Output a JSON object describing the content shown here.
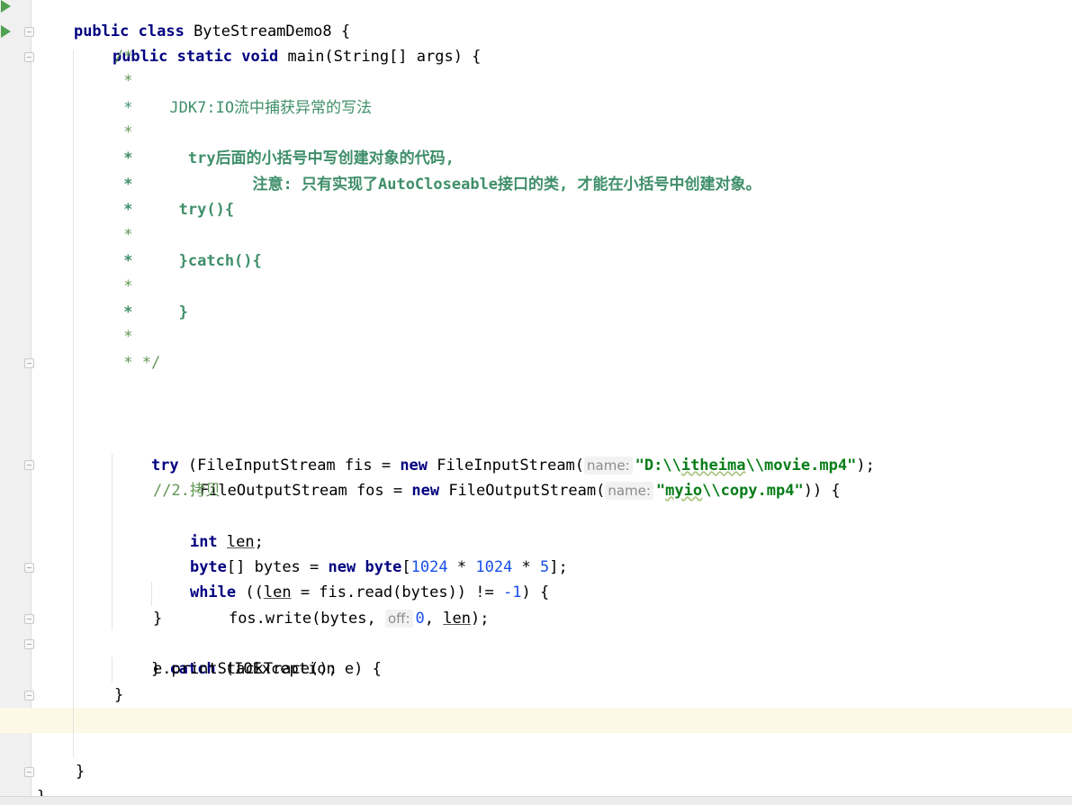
{
  "code": {
    "class_decl": {
      "kw1": "public",
      "kw2": "class",
      "name": "ByteStreamDemo8",
      "brace": " {"
    },
    "main_decl": {
      "kw1": "public",
      "kw2": "static",
      "kw3": "void",
      "rest": " main(String[] args) {"
    },
    "comment": [
      "/*",
      " *",
      " *    JDK7:IO流中捕获异常的写法",
      " *",
      " *      try后面的小括号中写创建对象的代码,",
      " *             注意: 只有实现了AutoCloseable接口的类, 才能在小括号中创建对象。",
      " *     try(){",
      " *",
      " *     }catch(){",
      " *",
      " *     }",
      " *",
      " * */"
    ],
    "try_line": {
      "kw": "try",
      "before_new": " (FileInputStream fis = ",
      "new": "new",
      "ctor": " FileInputStream(",
      "hint": "name:",
      "str_open": "\"D:",
      "str_esc1": "\\\\",
      "str_word": "itheima",
      "str_esc2": "\\\\",
      "str_rest": "movie.mp4\"",
      "end": ");"
    },
    "fos_line": {
      "before_new": "FileOutputStream fos = ",
      "new": "new",
      "ctor": " FileOutputStream(",
      "hint": "name:",
      "str_open": "\"",
      "str_word": "myio",
      "str_esc": "\\\\",
      "str_rest": "copy.mp4\"",
      "end": ")) {"
    },
    "copy_comment": "//2.拷贝",
    "int_line": {
      "kw": "int",
      "var": "len",
      "end": ";"
    },
    "byte_line": {
      "kw1": "byte",
      "mid": "[] bytes = ",
      "kw2": "new",
      "kw3": "byte",
      "open": "[",
      "n1": "1024",
      "op1": " * ",
      "n2": "1024",
      "op2": " * ",
      "n3": "5",
      "end": "];"
    },
    "while_line": {
      "kw": "while",
      "open": " ((",
      "var": "len",
      "mid": " = fis.read(bytes)) != ",
      "num": "-1",
      "end": ") {"
    },
    "write_line": {
      "start": "fos.write(bytes, ",
      "hint": "off:",
      "num": "0",
      "sep": ", ",
      "var": "len",
      "end": ");"
    },
    "close_brace": "}",
    "catch_line": {
      "open": "} ",
      "kw": "catch",
      "rest": " (IOException e) {"
    },
    "print_line": "e.printStackTrace();",
    "final_brace": "}"
  },
  "colors": {
    "keyword": "#000080",
    "string": "#067d17",
    "number": "#1750eb",
    "comment": "#3f8f6a",
    "line_comment": "#629755",
    "caret_row": "#fdf9e6",
    "run_icon": "#4fa04f"
  },
  "icons": {
    "gutter_run": "run-triangle-icon",
    "gutter_fold": "fold-icon",
    "mouse": "mouse-pointer-icon"
  }
}
